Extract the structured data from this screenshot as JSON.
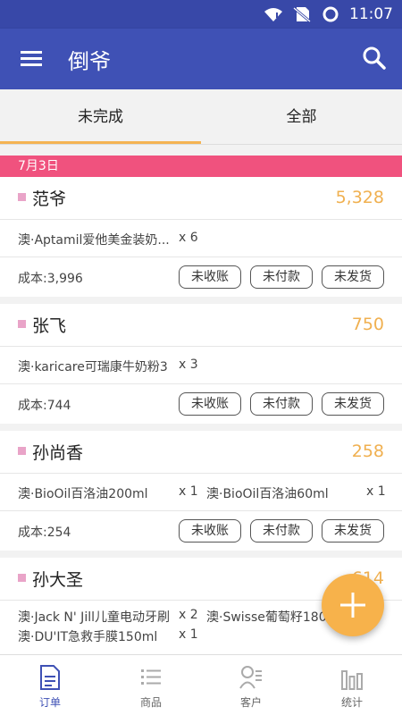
{
  "status_bar": {
    "time": "11:07",
    "icons": [
      "wifi-alert-icon",
      "no-sim-icon",
      "circle-status-icon"
    ]
  },
  "app_bar": {
    "title": "倒爷",
    "icons": [
      "menu-icon",
      "search-icon"
    ]
  },
  "tabs": [
    {
      "label": "未完成",
      "active": true
    },
    {
      "label": "全部",
      "active": false
    }
  ],
  "date_header": "7月3日",
  "colors": {
    "primary": "#3f51b5",
    "accent": "#f5b453",
    "date_band": "#f0527e",
    "total": "#f0b050",
    "marker": "#e9a4c8"
  },
  "orders": [
    {
      "name": "范爷",
      "total": "5,328",
      "items": [
        {
          "name": "澳·Aptamil爱他美金装奶...",
          "qty": "x 6"
        }
      ],
      "cost": "成本:3,996",
      "buttons": [
        "未收账",
        "未付款",
        "未发货"
      ]
    },
    {
      "name": "张飞",
      "total": "750",
      "items": [
        {
          "name": "澳·karicare可瑞康牛奶粉3",
          "qty": "x 3"
        }
      ],
      "cost": "成本:744",
      "buttons": [
        "未收账",
        "未付款",
        "未发货"
      ]
    },
    {
      "name": "孙尚香",
      "total": "258",
      "items": [
        {
          "name": "澳·BioOil百洛油200ml",
          "qty": "x 1"
        },
        {
          "name": "澳·BioOil百洛油60ml",
          "qty": "x 1"
        }
      ],
      "cost": "成本:254",
      "buttons": [
        "未收账",
        "未付款",
        "未发货"
      ]
    },
    {
      "name": "孙大圣",
      "total": "614",
      "items": [
        {
          "name": "澳·Jack N' Jill儿童电动牙刷",
          "qty": "x 2"
        },
        {
          "name": "澳·Swisse葡萄籽180",
          "qty": ""
        },
        {
          "name": "澳·DU'IT急救手膜150ml",
          "qty": "x 1"
        }
      ]
    }
  ],
  "fab": {
    "icon": "plus-icon"
  },
  "bottom_nav": [
    {
      "label": "订单",
      "icon": "document-icon",
      "active": true
    },
    {
      "label": "商品",
      "icon": "list-icon",
      "active": false
    },
    {
      "label": "客户",
      "icon": "contacts-icon",
      "active": false
    },
    {
      "label": "统计",
      "icon": "bar-chart-icon",
      "active": false
    }
  ]
}
